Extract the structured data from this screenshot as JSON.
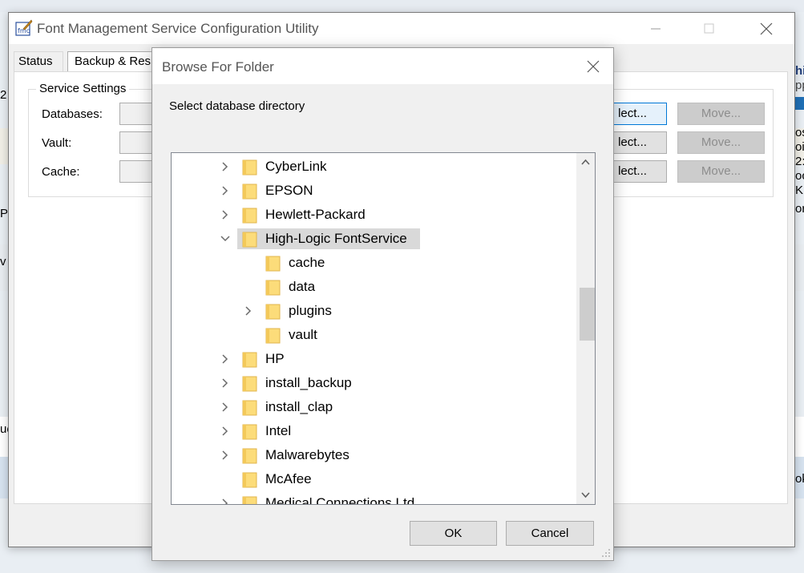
{
  "main_window": {
    "title": "Font Management Service Configuration Utility",
    "tabs": [
      {
        "label": "Status"
      },
      {
        "label": "Backup & Res"
      }
    ],
    "group_title": "Service Settings",
    "rows": [
      {
        "label": "Databases:",
        "select_label": "lect...",
        "move_label": "Move..."
      },
      {
        "label": "Vault:",
        "select_label": "lect...",
        "move_label": "Move..."
      },
      {
        "label": "Cache:",
        "select_label": "lect...",
        "move_label": "Move..."
      }
    ]
  },
  "background": {
    "left_fragments": [
      "2",
      "Pr",
      "ue",
      "v"
    ],
    "right_fragments": [
      "hi",
      "pp",
      "os",
      "oi",
      "2:",
      "oc",
      "K",
      "or",
      "ok"
    ]
  },
  "dialog": {
    "title": "Browse For Folder",
    "instruction": "Select database directory",
    "ok_label": "OK",
    "cancel_label": "Cancel",
    "tree": [
      {
        "label": "CyberLink",
        "depth": 0,
        "expander": "collapsed",
        "selected": false
      },
      {
        "label": "EPSON",
        "depth": 0,
        "expander": "collapsed",
        "selected": false
      },
      {
        "label": "Hewlett-Packard",
        "depth": 0,
        "expander": "collapsed",
        "selected": false
      },
      {
        "label": "High-Logic FontService",
        "depth": 0,
        "expander": "expanded",
        "selected": true
      },
      {
        "label": "cache",
        "depth": 1,
        "expander": "none",
        "selected": false
      },
      {
        "label": "data",
        "depth": 1,
        "expander": "none",
        "selected": false
      },
      {
        "label": "plugins",
        "depth": 1,
        "expander": "collapsed",
        "selected": false
      },
      {
        "label": "vault",
        "depth": 1,
        "expander": "none",
        "selected": false
      },
      {
        "label": "HP",
        "depth": 0,
        "expander": "collapsed",
        "selected": false
      },
      {
        "label": "install_backup",
        "depth": 0,
        "expander": "collapsed",
        "selected": false
      },
      {
        "label": "install_clap",
        "depth": 0,
        "expander": "collapsed",
        "selected": false
      },
      {
        "label": "Intel",
        "depth": 0,
        "expander": "collapsed",
        "selected": false
      },
      {
        "label": "Malwarebytes",
        "depth": 0,
        "expander": "collapsed",
        "selected": false
      },
      {
        "label": "McAfee",
        "depth": 0,
        "expander": "none",
        "selected": false
      },
      {
        "label": "Medical Connections Ltd",
        "depth": 0,
        "expander": "collapsed",
        "selected": false
      }
    ]
  },
  "colors": {
    "folder_fill": "#fcdc7a",
    "folder_edge": "#e0b44c",
    "selection": "#d9d9d9",
    "accent": "#0078d7"
  }
}
